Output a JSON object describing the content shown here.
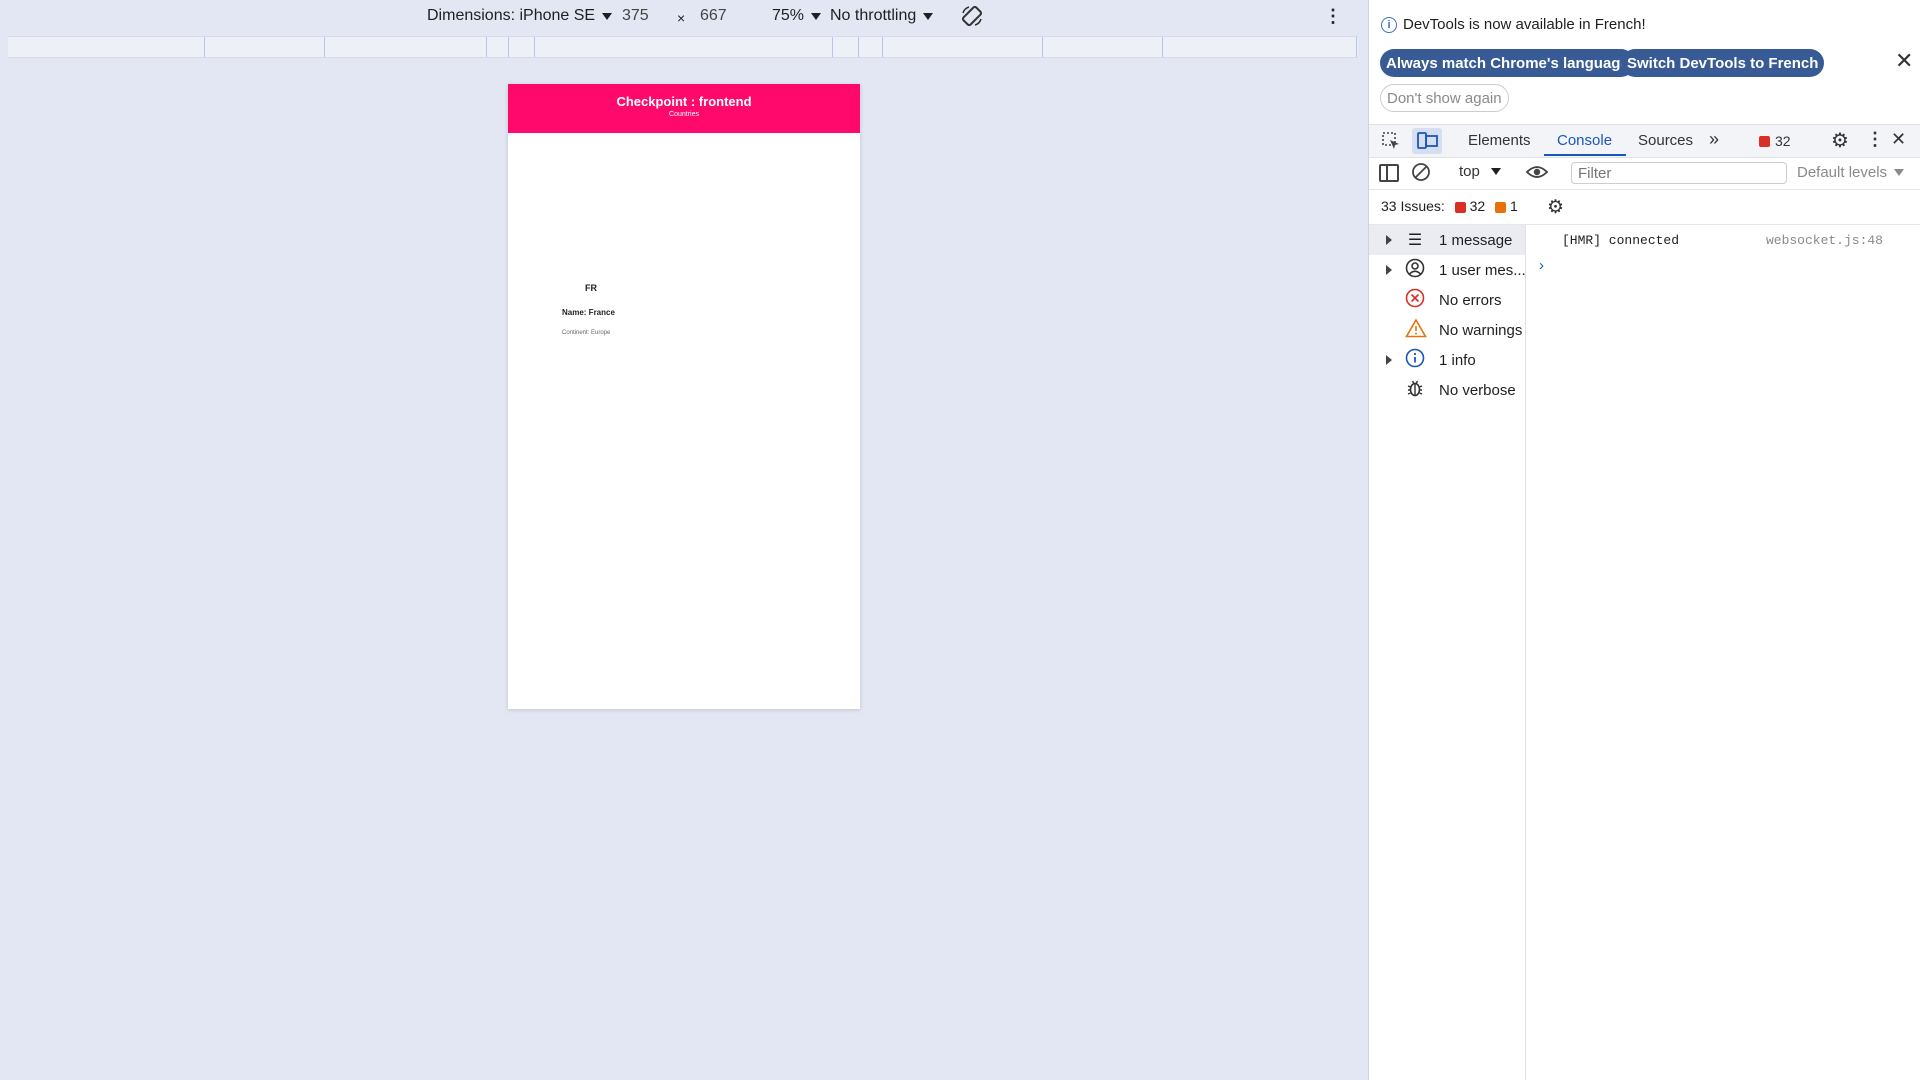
{
  "toolbar": {
    "dimensions_label": "Dimensions: iPhone SE",
    "width": "375",
    "times": "×",
    "height": "667",
    "zoom": "75%",
    "throttling": "No throttling"
  },
  "site": {
    "title": "Checkpoint : frontend",
    "subtitle": "Countries",
    "header_color": "#ff0a6c",
    "country": {
      "code": "FR",
      "name": "Name: France",
      "continent": "Continent: Europe"
    }
  },
  "devtools": {
    "infobar": {
      "message": "DevTools is now available in French!",
      "match_language": "Always match Chrome's language",
      "switch_french": "Switch DevTools to French",
      "dont_show": "Don't show again"
    },
    "tabs": [
      "Elements",
      "Console",
      "Sources"
    ],
    "active_tab": "Console",
    "error_badge_count": "32",
    "context": "top",
    "filter_placeholder": "Filter",
    "levels": "Default levels",
    "issues": {
      "label": "33 Issues:",
      "errors": "32",
      "warnings": "1"
    },
    "sidebar": [
      {
        "label": "1 message",
        "icon": "list-icon"
      },
      {
        "label": "1 user mes...",
        "icon": "user-icon"
      },
      {
        "label": "No errors",
        "icon": "error-icon"
      },
      {
        "label": "No warnings",
        "icon": "warning-icon"
      },
      {
        "label": "1 info",
        "icon": "info-icon"
      },
      {
        "label": "No verbose",
        "icon": "bug-icon"
      }
    ],
    "log": {
      "message": "[HMR] connected",
      "source": "websocket.js:48"
    },
    "accent_color": "#1a56b8",
    "button_color": "#385a95"
  }
}
